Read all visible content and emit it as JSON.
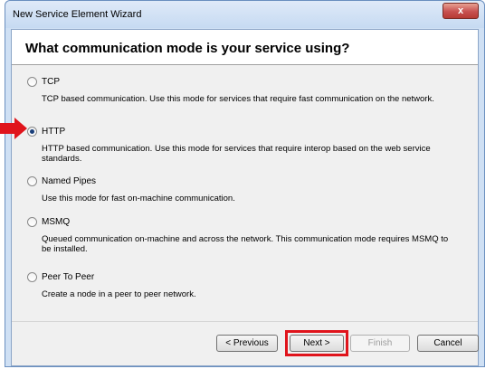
{
  "window": {
    "title": "New Service Element Wizard",
    "close_glyph": "x"
  },
  "header": {
    "title": "What communication mode is your service using?"
  },
  "options": [
    {
      "label": "TCP",
      "description": "TCP based communication. Use this mode for services that require fast communication on the network.",
      "selected": false
    },
    {
      "label": "HTTP",
      "description": "HTTP based communication. Use this mode for services that require interop based on the web service standards.",
      "selected": true
    },
    {
      "label": "Named Pipes",
      "description": "Use this mode for fast on-machine communication.",
      "selected": false
    },
    {
      "label": "MSMQ",
      "description": "Queued communication on-machine and across the network. This communication mode requires MSMQ to be installed.",
      "selected": false
    },
    {
      "label": "Peer To Peer",
      "description": "Create a node in a peer to peer network.",
      "selected": false
    }
  ],
  "buttons": {
    "previous": "< Previous",
    "next": "Next >",
    "finish": "Finish",
    "cancel": "Cancel"
  },
  "annotations": {
    "highlight_color": "#e0141c",
    "arrow_icon": "red-arrow-icon"
  }
}
